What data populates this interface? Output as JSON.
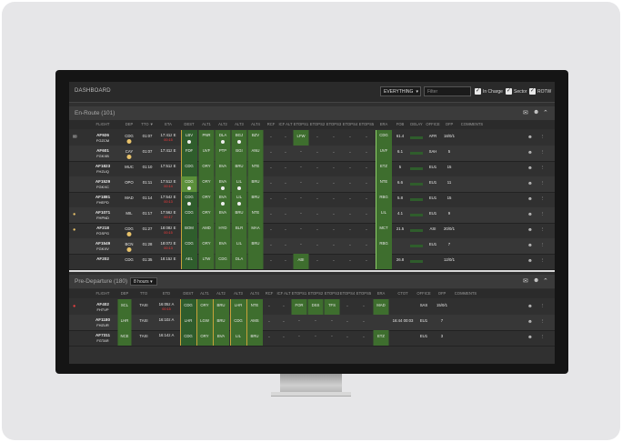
{
  "dashboard": {
    "title": "DASHBOARD",
    "view_select": "EVERYTHING",
    "filter_placeholder": "Filter",
    "checks": [
      "In Charge",
      "Sector",
      "ROTW"
    ]
  },
  "enroute": {
    "title": "En-Route (101)",
    "columns": [
      "FLIGHT",
      "DEP",
      "TTO ▼",
      "ETA",
      "DEST",
      "ALT1",
      "ALT2",
      "ALT3",
      "ALT4",
      "RCF",
      "ICF ALT",
      "ETOPS1",
      "ETOPS2",
      "ETOPS3",
      "ETOPS4",
      "ETOPS5",
      "ERA",
      "FOB",
      "DELAY",
      "OFFICE",
      "OFP",
      "COMMENTS"
    ],
    "rows": [
      {
        "flight": "AF926",
        "reg": "FGZCM",
        "dep": "CDG",
        "tto": "01:07",
        "eta": "17:41z E",
        "eta_sub": "00:15",
        "dest": "LBV",
        "alt1": "PNR",
        "alt2": "DLA",
        "alt3": "BGJ",
        "alt4": "BZV",
        "etops1": "LFW",
        "era": "CDG",
        "fob": "61.4",
        "office": "AFR",
        "ofp": "18/0/1"
      },
      {
        "flight": "AF601",
        "reg": "FGKXB",
        "dep": "CAY",
        "tto": "01:07",
        "eta": "17:41z E",
        "eta_sub": "",
        "dest": "FDF",
        "alt1": "UVF",
        "alt2": "PTP",
        "alt3": "BGI",
        "alt4": "ANU",
        "etops1": "-",
        "era": "UVF",
        "fob": "6.1",
        "office": "SAH",
        "ofp": "5"
      },
      {
        "flight": "AF1823",
        "reg": "FHZUQ",
        "dep": "MUC",
        "tto": "01:10",
        "eta": "17:51z E",
        "eta_sub": "",
        "dest": "CDG",
        "alt1": "ORY",
        "alt2": "BVA",
        "alt3": "BRU",
        "alt4": "NTE",
        "etops1": "-",
        "era": "ETZ",
        "fob": "5",
        "office": "EU1",
        "ofp": "15"
      },
      {
        "flight": "AF1529",
        "reg": "FGKXC",
        "dep": "OPO",
        "tto": "01:11",
        "eta": "17:51z E",
        "eta_sub": "00:14",
        "dest": "CDG",
        "alt1": "ORY",
        "alt2": "BVA",
        "alt3": "LIL",
        "alt4": "BRU",
        "etops1": "-",
        "era": "NTE",
        "fob": "6.6",
        "office": "EU1",
        "ofp": "11"
      },
      {
        "flight": "AF1881",
        "reg": "FHEPD",
        "dep": "MAD",
        "tto": "01:14",
        "eta": "17:54z E",
        "eta_sub": "00:13",
        "dest": "CDG",
        "alt1": "ORY",
        "alt2": "BVA",
        "alt3": "LIL",
        "alt4": "BRU",
        "etops1": "-",
        "era": "RBG",
        "fob": "5.8",
        "office": "EU1",
        "ofp": "15"
      },
      {
        "flight": "AF1071",
        "reg": "FHPND",
        "dep": "MIL",
        "tto": "01:17",
        "eta": "17:56z E",
        "eta_sub": "00:17",
        "dest": "CDG",
        "alt1": "ORY",
        "alt2": "BVA",
        "alt3": "BRU",
        "alt4": "NTE",
        "etops1": "-",
        "era": "LIL",
        "fob": "4.1",
        "office": "EU1",
        "ofp": "9"
      },
      {
        "flight": "AF218",
        "reg": "FGSPG",
        "dep": "CDG",
        "tto": "01:27",
        "eta": "18:08z E",
        "eta_sub": "00:15",
        "dest": "BOM",
        "alt1": "AMD",
        "alt2": "HYD",
        "alt3": "BLR",
        "alt4": "MAA",
        "etops1": "-",
        "era": "MCT",
        "fob": "21.5",
        "office": "ASI",
        "ofp": "20/0/1"
      },
      {
        "flight": "AF1549",
        "reg": "FGKXV",
        "dep": "BCN",
        "tto": "01:28",
        "eta": "18:07z E",
        "eta_sub": "00:13",
        "dest": "CDG",
        "alt1": "ORY",
        "alt2": "BVA",
        "alt3": "LIL",
        "alt4": "BRU",
        "etops1": "-",
        "era": "RBG",
        "fob": "",
        "office": "EU1",
        "ofp": "7"
      },
      {
        "flight": "AF202",
        "reg": "",
        "dep": "CDG",
        "tto": "01:35",
        "eta": "18:15z E",
        "eta_sub": "",
        "dest": "AEL",
        "alt1": "LTW",
        "alt2": "CDG",
        "alt3": "DLA",
        "alt4": "",
        "etops1": "ABI",
        "era": "",
        "fob": "26.8",
        "office": "",
        "ofp": "12/0/1"
      }
    ]
  },
  "predeparture": {
    "title": "Pre-Departure (180)",
    "hours": "8 hours",
    "columns": [
      "FLIGHT",
      "DEP",
      "TTO",
      "ETD",
      "DEST",
      "ALT1",
      "ALT2",
      "ALT3",
      "ALT4",
      "RCF",
      "ICF ALT",
      "ETOPS1",
      "ETOPS2",
      "ETOPS3",
      "ETOPS4",
      "ETOPS5",
      "ERA",
      "CTOT",
      "OFFICE",
      "OFP",
      "COMMENTS"
    ],
    "rows": [
      {
        "flight": "AF402",
        "reg": "FHTVP",
        "dep": "SCL",
        "tto": "TAXI",
        "etd": "16:05z A",
        "etd_sub": "00:15",
        "dest": "CDG",
        "alt1": "ORY",
        "alt2": "BRU",
        "alt3": "LHR",
        "alt4": "NTE",
        "etops1": "FOR",
        "etops2": "DSS",
        "etops3": "TFS",
        "era": "MAD",
        "ctot": "",
        "office": "SAS",
        "ofp": "15/0/1"
      },
      {
        "flight": "AF1180",
        "reg": "FHZUR",
        "dep": "LHR",
        "tto": "TAXI",
        "etd": "16:10z A",
        "etd_sub": "",
        "dest": "LHR",
        "alt1": "LGW",
        "alt2": "BRU",
        "alt3": "CDG",
        "alt4": "AMS",
        "etops1": "",
        "etops2": "",
        "etops3": "",
        "era": "",
        "ctot": "16:44 00:03",
        "office": "EU1",
        "ofp": "7"
      },
      {
        "flight": "AF7311",
        "reg": "FGTAR",
        "dep": "NCE",
        "tto": "TAXI",
        "etd": "16:14z A",
        "etd_sub": "",
        "dest": "CDG",
        "alt1": "ORY",
        "alt2": "BVA",
        "alt3": "LIL",
        "alt4": "BRU",
        "etops1": "",
        "etops2": "",
        "etops3": "",
        "era": "ETZ",
        "ctot": "",
        "office": "EU1",
        "ofp": "3"
      }
    ]
  },
  "icons": [
    "mail-icon",
    "people-icon",
    "chevron-up-icon",
    "kebab-icon",
    "warning-icon"
  ]
}
